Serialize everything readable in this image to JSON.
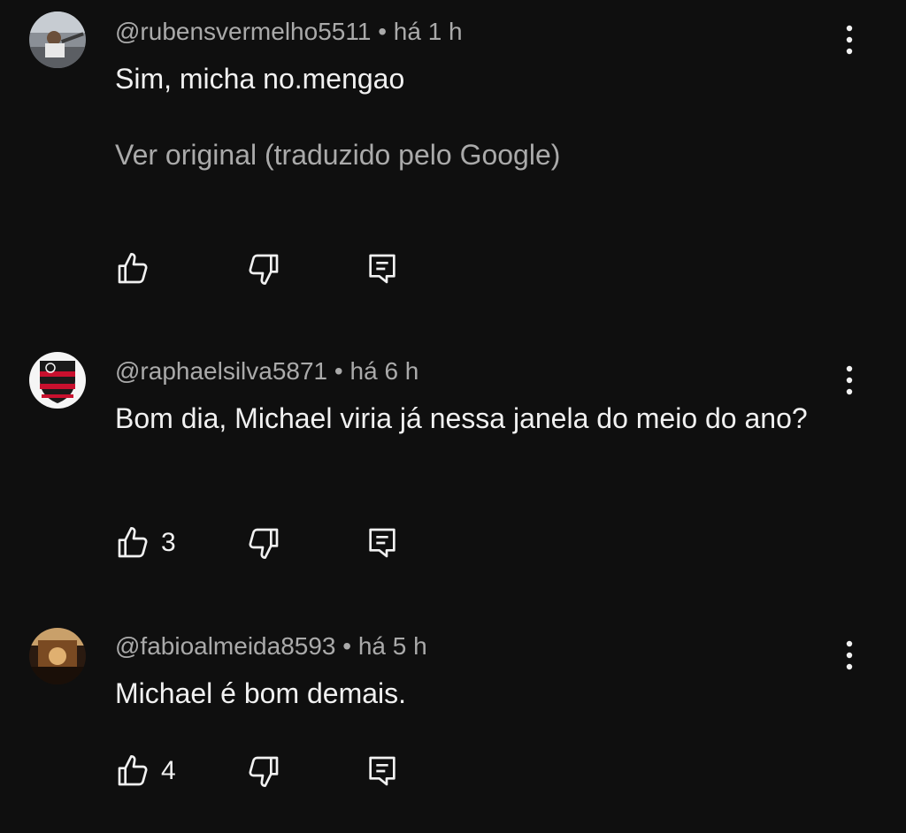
{
  "comments": [
    {
      "author": "@rubensvermelho5511",
      "time": "há 1 h",
      "text": "Sim, micha no.mengao",
      "translate_link": "Ver original (traduzido pelo Google)",
      "likes": ""
    },
    {
      "author": "@raphaelsilva5871",
      "time": "há 6 h",
      "text": "Bom dia, Michael viria já nessa janela do meio do ano?",
      "likes": "3"
    },
    {
      "author": "@fabioalmeida8593",
      "time": "há 5 h",
      "text": "Michael é bom demais.",
      "likes": "4"
    }
  ],
  "separator": "•",
  "icons": [
    "thumbs-up-icon",
    "thumbs-down-icon",
    "reply-icon",
    "more-vert-icon"
  ],
  "colors": {
    "background": "#0f0f0f",
    "text": "#f1f1f1",
    "secondary": "#aaaaaa"
  }
}
